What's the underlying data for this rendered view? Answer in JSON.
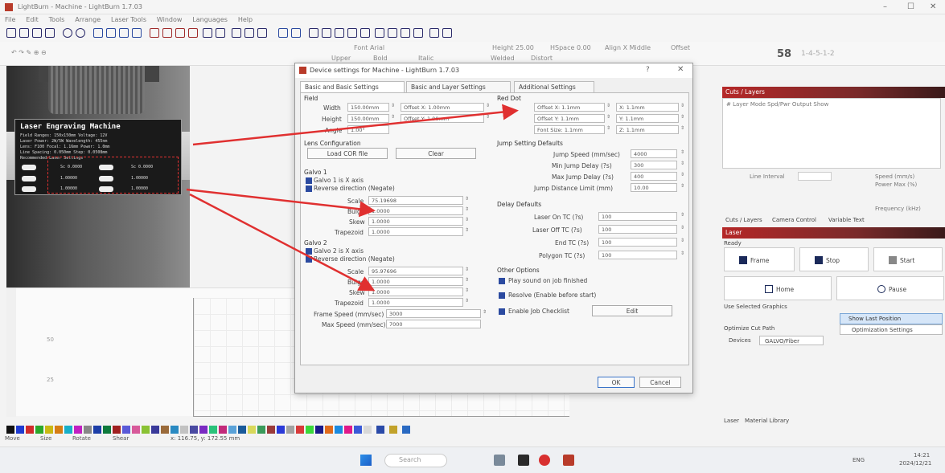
{
  "window": {
    "title": "LightBurn - Machine - LightBurn 1.7.03",
    "minimize": "–",
    "maximize": "☐",
    "close": "✕"
  },
  "menu": [
    "File",
    "Edit",
    "Tools",
    "Arrange",
    "Laser Tools",
    "Window",
    "Languages",
    "Help"
  ],
  "toolbar2": {
    "font_label": "Font Arial",
    "height_label": "Height 25.00",
    "hspace_label": "HSpace 0.00",
    "align_label": "Align X Middle",
    "offset_label": "Offset",
    "upper": "Upper",
    "bold": "Bold",
    "italic": "Italic",
    "welded": "Welded",
    "distort": "Distort",
    "zoom": "58",
    "layer_shortcut": "1-4-5-1-2"
  },
  "photo": {
    "plate_title": "Laser Engraving Machine",
    "plate_lines": [
      "Field Ranges: 150x150mm   Voltage: 12V",
      "Laser Power: 2W/5W   Wavelength: 455nm",
      "Lens: F100   Focal: 1.16mm   Power: 1.0mm",
      "Line Spacing: 0.050mm   Step: 0.0508mm",
      "Recommended Laser Settings"
    ],
    "plate_cells": [
      [
        "Sc 0.0000",
        "Sc 0.0000"
      ],
      [
        "1.00000",
        "1.00000"
      ],
      [
        "1.00000",
        "1.00000"
      ]
    ]
  },
  "dialog": {
    "title": "Device settings for Machine - LightBurn 1.7.03",
    "help": "?",
    "close": "✕",
    "tabs": [
      "Basic and Basic Settings",
      "Basic and Layer Settings",
      "Additional Settings"
    ],
    "field_section": "Field",
    "width_label": "Width",
    "width_value": "150.00mm",
    "width_offset": "Offset X: 1.00mm",
    "height_label": "Height",
    "height_value": "150.00mm",
    "height_offset": "Offset Y: 1.00mm",
    "angle_label": "Angle",
    "angle_value": "1.00°",
    "lens_section": "Lens Configuration",
    "load_file": "Load COR file",
    "clear": "Clear",
    "galvo1_section": "Galvo 1",
    "galvo1_opt1": "Galvo 1 is X axis",
    "galvo1_opt2": "Reverse direction (Negate)",
    "scale1_label": "Scale",
    "scale1_value": "75.19698",
    "bulge1_label": "Bulge",
    "bulge1_value": "1.0000",
    "skew1_label": "Skew",
    "skew1_value": "1.0000",
    "trap1_label": "Trapezoid",
    "trap1_value": "1.0000",
    "galvo2_section": "Galvo 2",
    "galvo2_opt1": "Galvo 2 is X axis",
    "galvo2_opt2": "Reverse direction (Negate)",
    "scale2_label": "Scale",
    "scale2_value": "95.97696",
    "bulge2_label": "Bulge",
    "bulge2_value": "1.0000",
    "skew2_label": "Skew",
    "skew2_value": "1.0000",
    "trap2_label": "Trapezoid",
    "trap2_value": "1.0000",
    "frame_speed_label": "Frame Speed (mm/sec)",
    "frame_speed_value": "3000",
    "max_speed_label": "Max Speed (mm/sec)",
    "max_speed_value": "7000",
    "red_dot_section": "Red Dot",
    "red_offset_x": "Offset X: 1.1mm",
    "red_offset_y": "Offset Y: 1.1mm",
    "red_font_size": "Font Size: 1.1mm",
    "red_scale_x": "X: 1.1mm",
    "red_scale_y": "Y: 1.1mm",
    "red_scale_z": "Z: 1.1mm",
    "jump_section": "Jump Setting Defaults",
    "jump_speed_label": "Jump Speed (mm/sec)",
    "jump_speed_value": "4000",
    "min_jump_label": "Min Jump Delay (?s)",
    "min_jump_value": "300",
    "max_jump_label": "Max Jump Delay (?s)",
    "max_jump_value": "400",
    "jump_dist_label": "Jump Distance Limit (mm)",
    "jump_dist_value": "10.00",
    "delay_section": "Delay Defaults",
    "laser_on_label": "Laser On TC (?s)",
    "laser_on_value": "100",
    "laser_off_label": "Laser Off TC (?s)",
    "laser_off_value": "100",
    "end_tc_label": "End TC (?s)",
    "end_tc_value": "100",
    "polygon_label": "Polygon TC (?s)",
    "polygon_value": "100",
    "other_section": "Other Options",
    "opt_play_sound": "Play sound on job finished",
    "opt_resolve": "Resolve (Enable before start)",
    "opt_checklist": "Enable Job Checklist",
    "edit_btn": "Edit",
    "ok_btn": "OK",
    "cancel_btn": "Cancel"
  },
  "right_panel": {
    "cuts_header": "Cuts / Layers",
    "cuts_cols": "# Layer Mode Spd/Pwr Output Show",
    "cuts_lines": [
      "Line Interval",
      "Speed (mm/s)",
      "Power Max (%)",
      "Frequency (kHz)"
    ],
    "cut_tabs": [
      "Cuts / Layers",
      "Camera Control",
      "Variable Text"
    ],
    "laser_header": "Laser",
    "ready": "Ready",
    "frame": "Frame",
    "stop": "Stop",
    "start": "Start",
    "home": "Home",
    "pause": "Pause",
    "opt_selected": "Use Selected Graphics",
    "opt_optimize": "Optimize Cut Path",
    "show_last": "Show Last Position",
    "opt_settings": "Optimization Settings",
    "device_label": "Devices",
    "device_value": "GALVO/Fiber",
    "bottom_tabs": [
      "Laser",
      "Material Library"
    ]
  },
  "status": {
    "move": "Move",
    "size": "Size",
    "rotate": "Rotate",
    "shear": "Shear",
    "coords": "x: 116.75, y: 172.55 mm"
  },
  "taskbar": {
    "search": "Search",
    "tray": "ENG",
    "time": "14:21",
    "date": "2024/12/21"
  },
  "colors": {
    "accent_red": "#e03030",
    "panel_header": "#b52828",
    "dialog_bg": "#f0f0f0"
  }
}
